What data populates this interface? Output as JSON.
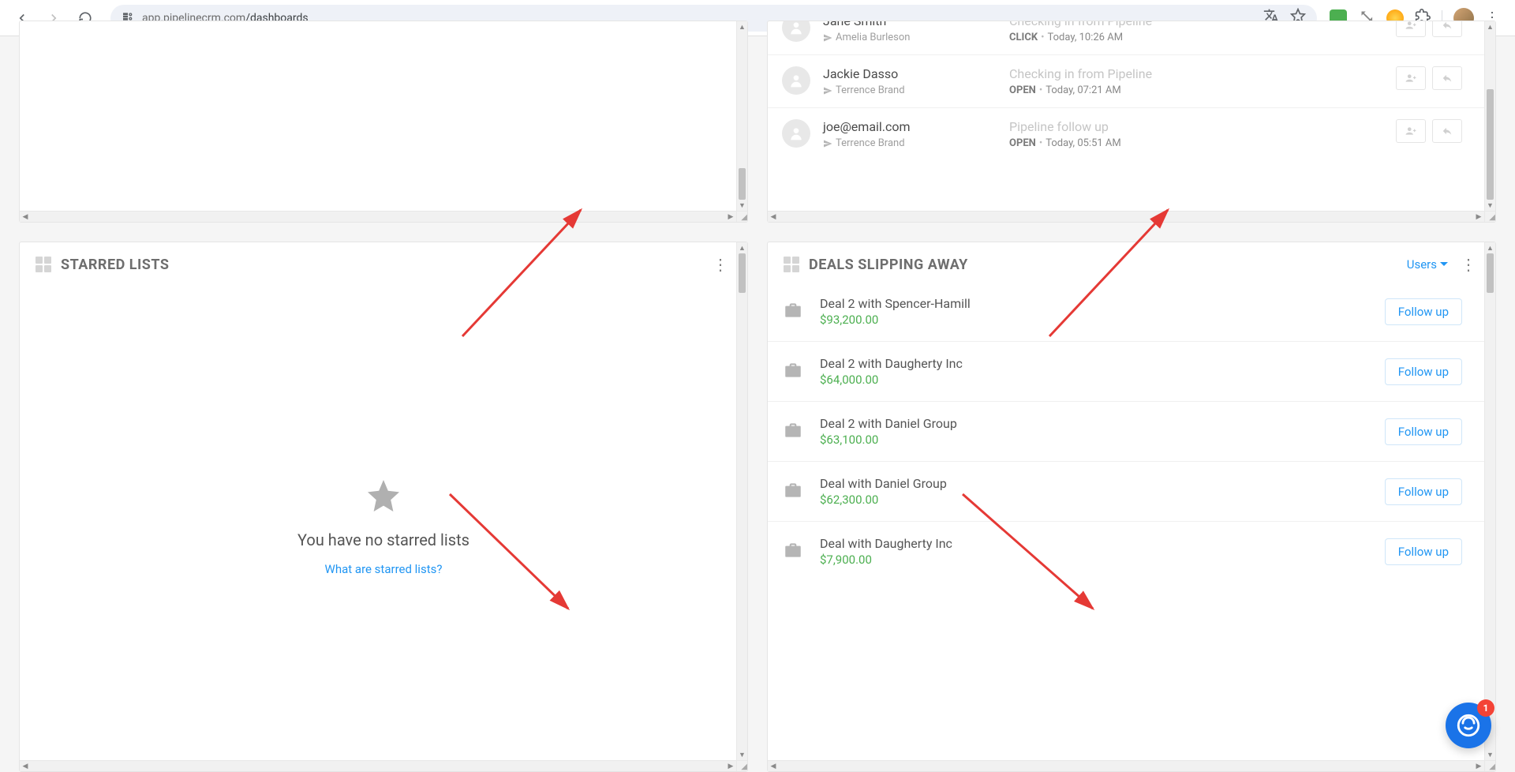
{
  "browser": {
    "url_host": "app.pipelinecrm.com",
    "url_path": "/dashboards"
  },
  "widgets": {
    "blank": {},
    "emails": {
      "rows": [
        {
          "name": "Jane Smith",
          "sender": "Amelia Burleson",
          "subject": "Checking in from Pipeline",
          "status": "CLICK",
          "time": "Today, 10:26 AM"
        },
        {
          "name": "Jackie Dasso",
          "sender": "Terrence Brand",
          "subject": "Checking in from Pipeline",
          "status": "OPEN",
          "time": "Today, 07:21 AM"
        },
        {
          "name": "joe@email.com",
          "sender": "Terrence Brand",
          "subject": "Pipeline follow up",
          "status": "OPEN",
          "time": "Today, 05:51 AM"
        }
      ]
    },
    "starred": {
      "title": "STARRED LISTS",
      "empty_text": "You have no starred lists",
      "empty_link": "What are starred lists?"
    },
    "deals": {
      "title": "DEALS SLIPPING AWAY",
      "filter_label": "Users",
      "followup_label": "Follow up",
      "rows": [
        {
          "name": "Deal 2 with Spencer-Hamill",
          "amount": "$93,200.00"
        },
        {
          "name": "Deal 2 with Daugherty Inc",
          "amount": "$64,000.00"
        },
        {
          "name": "Deal 2 with Daniel Group",
          "amount": "$63,100.00"
        },
        {
          "name": "Deal with Daniel Group",
          "amount": "$62,300.00"
        },
        {
          "name": "Deal with Daugherty Inc",
          "amount": "$7,900.00"
        }
      ]
    }
  },
  "chat_badge": "1"
}
